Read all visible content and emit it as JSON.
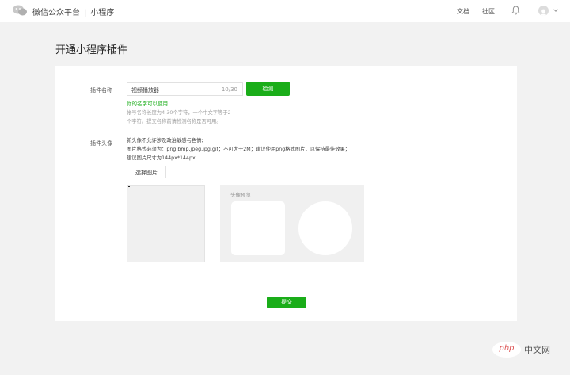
{
  "header": {
    "brand": "微信公众平台",
    "separator": "|",
    "product": "小程序",
    "nav": {
      "docs": "文档",
      "community": "社区"
    }
  },
  "page": {
    "title": "开通小程序插件"
  },
  "form": {
    "name_label": "插件名称",
    "name_value": "视频播放器",
    "name_count": "10/30",
    "check_button": "检测",
    "name_ok_hint": "你的名字可以使用",
    "name_hint_line1": "帐号名称长度为4-30个字符，一个中文字等于2",
    "name_hint_line2": "个字符。提交名称前请检测名称是否可用。",
    "avatar_label": "插件头像",
    "avatar_rule_1": "新头像不允许涉及政治敏感与色情;",
    "avatar_rule_2": "图片格式必须为：png,bmp,jpeg,jpg,gif；不可大于2M；建议使用png格式图片，以保持最佳效果；",
    "avatar_rule_3": "建议图片尺寸为144px*144px",
    "choose_button": "选择图片",
    "preview_label": "头像预览",
    "submit_button": "提交"
  },
  "watermark": {
    "logo": "php",
    "text": "中文网"
  },
  "colors": {
    "accent": "#1aad19",
    "background": "#f2f2f2"
  },
  "icons": [
    "wechat-logo-icon",
    "bell-icon",
    "user-avatar-icon",
    "chevron-down-icon"
  ]
}
